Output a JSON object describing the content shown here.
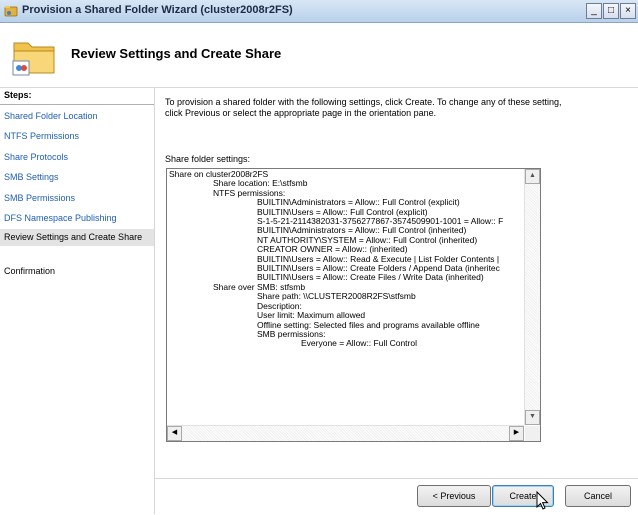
{
  "window": {
    "title": "Provision a Shared Folder Wizard (cluster2008r2FS)",
    "controls": [
      "_",
      "□",
      "×"
    ]
  },
  "header": {
    "title": "Review Settings and Create Share"
  },
  "steps": {
    "heading": "Steps:",
    "items": [
      {
        "label": "Shared Folder Location",
        "state": "link"
      },
      {
        "label": "NTFS Permissions",
        "state": "link"
      },
      {
        "label": "Share Protocols",
        "state": "link"
      },
      {
        "label": "SMB Settings",
        "state": "link"
      },
      {
        "label": "SMB Permissions",
        "state": "link"
      },
      {
        "label": "DFS Namespace Publishing",
        "state": "link"
      },
      {
        "label": "Review Settings and Create Share",
        "state": "current"
      },
      {
        "label": "Confirmation",
        "state": "pending"
      }
    ]
  },
  "main": {
    "intro": "To provision a shared folder with the following settings, click Create. To change any of these setting, click Previous or select the appropriate page in the orientation pane.",
    "settings_label": "Share folder settings:",
    "settings_lines": [
      {
        "indent": 0,
        "text": "Share on cluster2008r2FS"
      },
      {
        "indent": 1,
        "text": "Share location: E:\\stfsmb"
      },
      {
        "indent": 1,
        "text": "NTFS permissions:"
      },
      {
        "indent": 2,
        "text": "BUILTIN\\Administrators = Allow:: Full Control (explicit)"
      },
      {
        "indent": 2,
        "text": "BUILTIN\\Users = Allow:: Full Control (explicit)"
      },
      {
        "indent": 2,
        "text": "S-1-5-21-2114382031-3756277867-3574509901-1001 = Allow:: F"
      },
      {
        "indent": 2,
        "text": "BUILTIN\\Administrators = Allow:: Full Control (inherited)"
      },
      {
        "indent": 2,
        "text": "NT AUTHORITY\\SYSTEM = Allow:: Full Control (inherited)"
      },
      {
        "indent": 2,
        "text": "CREATOR OWNER = Allow:: (inherited)"
      },
      {
        "indent": 2,
        "text": "BUILTIN\\Users = Allow:: Read & Execute | List Folder Contents |"
      },
      {
        "indent": 2,
        "text": "BUILTIN\\Users = Allow:: Create Folders / Append Data (inheritec"
      },
      {
        "indent": 2,
        "text": "BUILTIN\\Users = Allow:: Create Files / Write Data (inherited)"
      },
      {
        "indent": 1,
        "text": "Share over SMB: stfsmb"
      },
      {
        "indent": 2,
        "text": "Share path: \\\\CLUSTER2008R2FS\\stfsmb"
      },
      {
        "indent": 2,
        "text": "Description:"
      },
      {
        "indent": 2,
        "text": "User limit: Maximum allowed"
      },
      {
        "indent": 2,
        "text": "Offline setting: Selected files and programs available offline"
      },
      {
        "indent": 2,
        "text": "SMB permissions:"
      },
      {
        "indent": 3,
        "text": "Everyone = Allow:: Full Control"
      }
    ]
  },
  "footer": {
    "previous_label": "< Previous",
    "create_label": "Create",
    "cancel_label": "Cancel"
  }
}
